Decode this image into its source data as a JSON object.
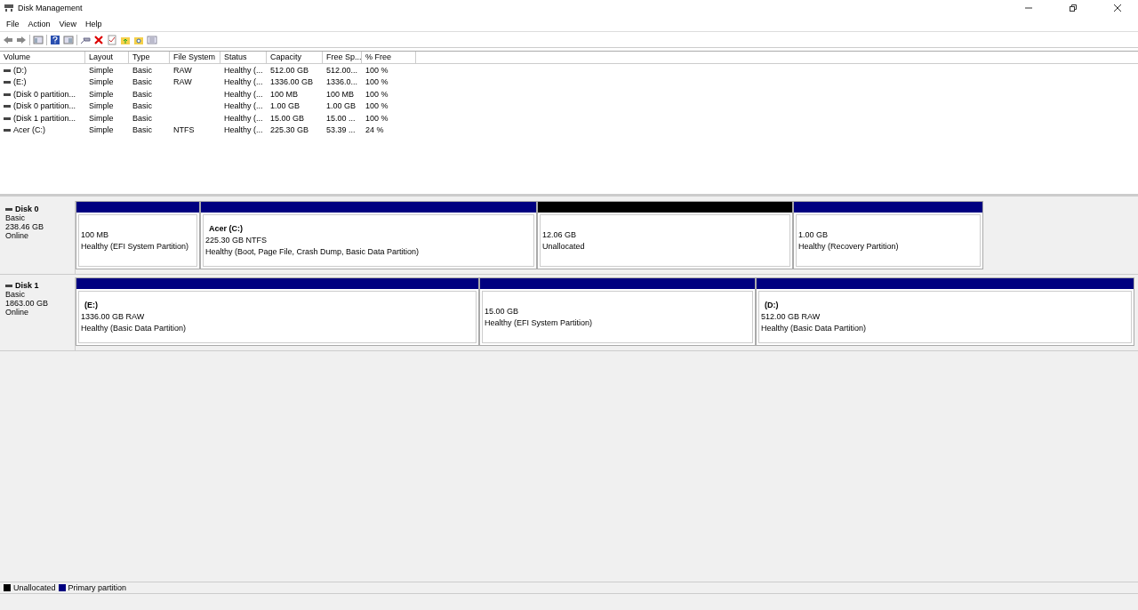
{
  "window": {
    "title": "Disk Management"
  },
  "menu": [
    "File",
    "Action",
    "View",
    "Help"
  ],
  "volume_list": {
    "columns": [
      "Volume",
      "Layout",
      "Type",
      "File System",
      "Status",
      "Capacity",
      "Free Sp...",
      "% Free"
    ],
    "rows": [
      [
        "(D:)",
        "Simple",
        "Basic",
        "RAW",
        "Healthy (...",
        "512.00 GB",
        "512.00...",
        "100 %"
      ],
      [
        "(E:)",
        "Simple",
        "Basic",
        "RAW",
        "Healthy (...",
        "1336.00 GB",
        "1336.0...",
        "100 %"
      ],
      [
        "(Disk 0 partition...",
        "Simple",
        "Basic",
        "",
        "Healthy (...",
        "100 MB",
        "100 MB",
        "100 %"
      ],
      [
        "(Disk 0 partition...",
        "Simple",
        "Basic",
        "",
        "Healthy (...",
        "1.00 GB",
        "1.00 GB",
        "100 %"
      ],
      [
        "(Disk 1 partition...",
        "Simple",
        "Basic",
        "",
        "Healthy (...",
        "15.00 GB",
        "15.00 ...",
        "100 %"
      ],
      [
        "Acer (C:)",
        "Simple",
        "Basic",
        "NTFS",
        "Healthy (...",
        "225.30 GB",
        "53.39 ...",
        "24 %"
      ]
    ]
  },
  "disks": [
    {
      "name": "Disk 0",
      "type": "Basic",
      "size": "238.46 GB",
      "status": "Online",
      "partitions": [
        {
          "kind": "primary",
          "size": "100 MB",
          "status": "Healthy (EFI System Partition)"
        },
        {
          "kind": "primary",
          "label": "Acer  (C:)",
          "size": "225.30 GB NTFS",
          "status": "Healthy (Boot, Page File, Crash Dump, Basic Data Partition)"
        },
        {
          "kind": "unallocated",
          "size": "12.06 GB",
          "status": "Unallocated"
        },
        {
          "kind": "primary",
          "size": "1.00 GB",
          "status": "Healthy (Recovery Partition)"
        }
      ]
    },
    {
      "name": "Disk 1",
      "type": "Basic",
      "size": "1863.00 GB",
      "status": "Online",
      "partitions": [
        {
          "kind": "primary",
          "label": "(E:)",
          "size": "1336.00 GB RAW",
          "status": "Healthy (Basic Data Partition)"
        },
        {
          "kind": "primary",
          "size": "15.00 GB",
          "status": "Healthy (EFI System Partition)"
        },
        {
          "kind": "primary",
          "label": "(D:)",
          "size": "512.00 GB RAW",
          "status": "Healthy (Basic Data Partition)"
        }
      ]
    }
  ],
  "legend": [
    {
      "label": "Unallocated",
      "color": "#000000"
    },
    {
      "label": "Primary partition",
      "color": "#000080"
    }
  ]
}
